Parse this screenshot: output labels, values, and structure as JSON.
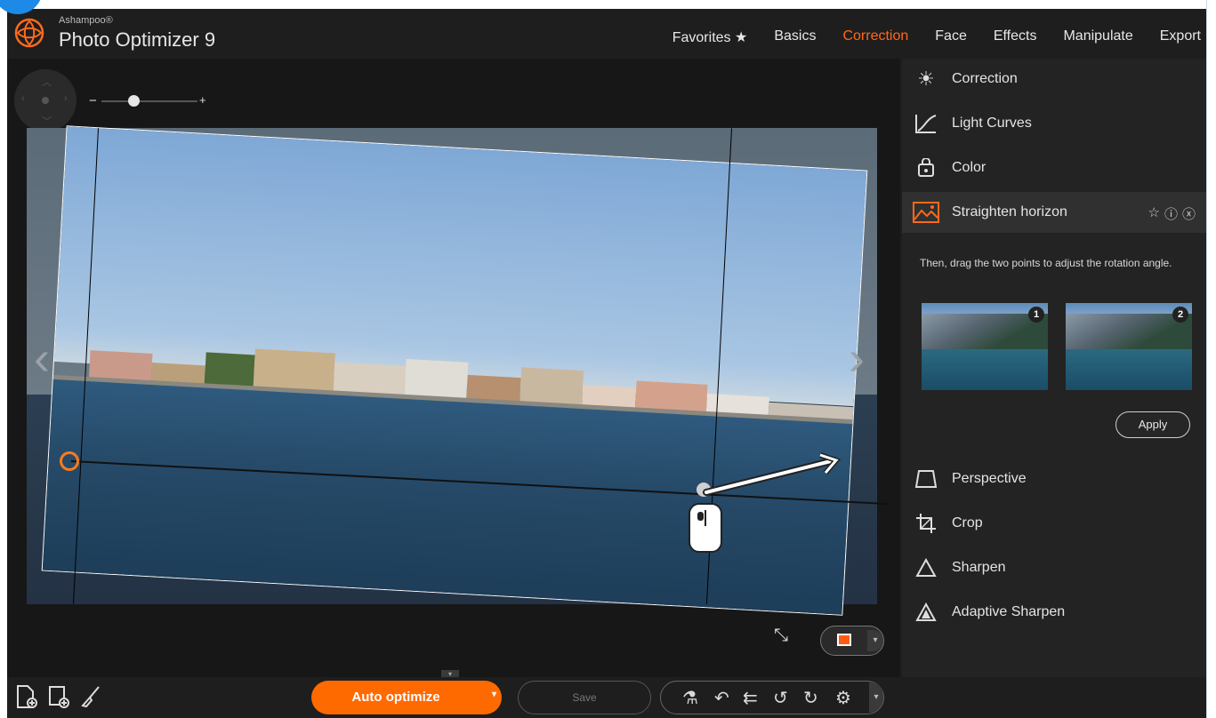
{
  "app": {
    "vendor": "Ashampoo®",
    "name": "Photo Optimizer 9"
  },
  "nav": {
    "items": [
      {
        "label": "Favorites ★",
        "active": false
      },
      {
        "label": "Basics",
        "active": false
      },
      {
        "label": "Correction",
        "active": true
      },
      {
        "label": "Face",
        "active": false
      },
      {
        "label": "Effects",
        "active": false
      },
      {
        "label": "Manipulate",
        "active": false
      },
      {
        "label": "Export",
        "active": false
      }
    ]
  },
  "zoom": {
    "minus": "−",
    "plus": "+",
    "level": 0.4
  },
  "panel": {
    "items": [
      {
        "label": "Correction",
        "icon": "sun-icon"
      },
      {
        "label": "Light Curves",
        "icon": "curve-icon"
      },
      {
        "label": "Color",
        "icon": "color-bucket-icon"
      },
      {
        "label": "Straighten horizon",
        "icon": "landscape-icon",
        "active": true
      }
    ],
    "hint": "Then, drag the two points to adjust the rotation angle.",
    "thumb1_num": "1",
    "thumb2_num": "2",
    "apply_label": "Apply",
    "items_lower": [
      {
        "label": "Perspective",
        "icon": "perspective-icon"
      },
      {
        "label": "Crop",
        "icon": "crop-icon"
      },
      {
        "label": "Sharpen",
        "icon": "triangle-icon"
      },
      {
        "label": "Adaptive Sharpen",
        "icon": "filled-triangle-icon"
      }
    ]
  },
  "bottombar": {
    "auto_label": "Auto optimize",
    "save_label": "Save"
  },
  "colors": {
    "accent": "#ff6a00",
    "active_nav": "#ff6a1a",
    "background": "#1e1e1e"
  }
}
